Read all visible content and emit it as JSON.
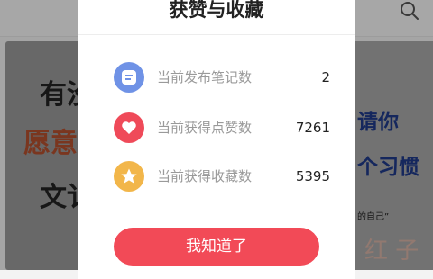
{
  "background": {
    "left_lines": [
      "有没",
      "愿意",
      "文讠"
    ],
    "right_lines": [
      "请你",
      "个习惯"
    ],
    "right_quote": "的自己”",
    "right_bottom": "红 子"
  },
  "modal": {
    "title": "获赞与收藏",
    "stats": [
      {
        "label": "当前发布笔记数",
        "value": "2",
        "icon": "note-icon",
        "color": "#6f92e6"
      },
      {
        "label": "当前获得点赞数",
        "value": "7261",
        "icon": "heart-icon",
        "color": "#ef4a59"
      },
      {
        "label": "当前获得收藏数",
        "value": "5395",
        "icon": "star-icon",
        "color": "#f2b64a"
      }
    ],
    "confirm_label": "我知道了"
  }
}
